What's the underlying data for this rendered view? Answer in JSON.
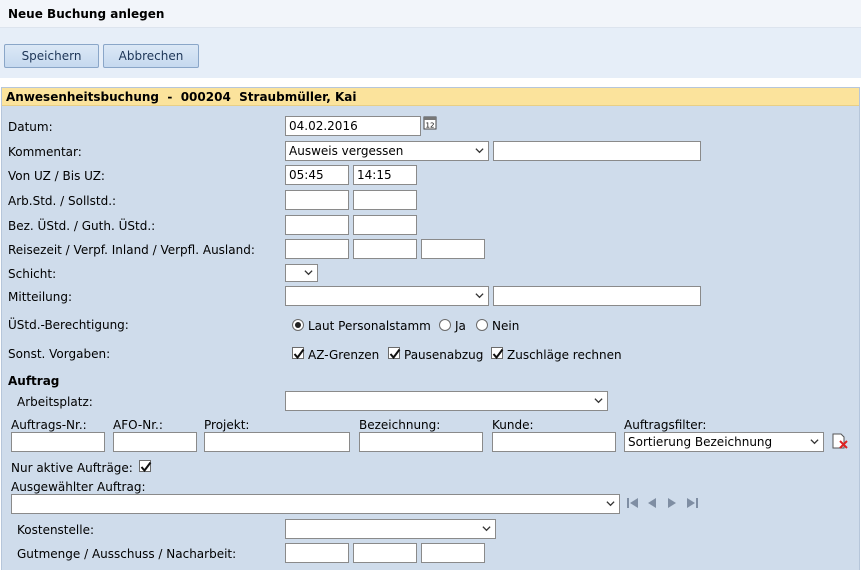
{
  "window": {
    "title": "Neue Buchung anlegen"
  },
  "toolbar": {
    "save_label": "Speichern",
    "cancel_label": "Abbrechen"
  },
  "panel": {
    "header": "Anwesenheitsbuchung  -  000204  Straubmüller, Kai"
  },
  "form": {
    "datum": {
      "label": "Datum:",
      "value": "04.02.2016"
    },
    "kommentar": {
      "label": "Kommentar:",
      "selected": "Ausweis vergessen",
      "text": ""
    },
    "von_bis": {
      "label": "Von UZ / Bis UZ:",
      "von": "05:45",
      "bis": "14:15"
    },
    "arb_soll": {
      "label": "Arb.Std. / Sollstd.:"
    },
    "bez_guth": {
      "label": "Bez. ÜStd. / Guth. ÜStd.:"
    },
    "reisezeit": {
      "label": "Reisezeit / Verpf. Inland / Verpfl. Ausland:"
    },
    "schicht": {
      "label": "Schicht:"
    },
    "mitteilung": {
      "label": "Mitteilung:"
    },
    "ustd": {
      "label": "ÜStd.-Berechtigung:",
      "options": [
        "Laut Personalstamm",
        "Ja",
        "Nein"
      ],
      "selected": "Laut Personalstamm"
    },
    "vorgaben": {
      "label": "Sonst. Vorgaben:",
      "options": [
        {
          "label": "AZ-Grenzen",
          "checked": true
        },
        {
          "label": "Pausenabzug",
          "checked": true
        },
        {
          "label": "Zuschläge rechnen",
          "checked": true
        }
      ]
    }
  },
  "auftrag": {
    "section_title": "Auftrag",
    "arbeitsplatz_label": "Arbeitsplatz:",
    "columns": {
      "auftrags_nr": "Auftrags-Nr.:",
      "afo_nr": "AFO-Nr.:",
      "projekt": "Projekt:",
      "bezeichnung": "Bezeichnung:",
      "kunde": "Kunde:",
      "filter": "Auftragsfilter:"
    },
    "filter_selected": "Sortierung Bezeichnung",
    "nur_aktive_label": "Nur aktive Aufträge:",
    "nur_aktive_checked": true,
    "ausgewaehlt_label": "Ausgewählter Auftrag:",
    "kostenstelle_label": "Kostenstelle:",
    "gutmenge_label": "Gutmenge / Ausschuss / Nacharbeit:"
  },
  "icons": {
    "calendar": "calendar-icon",
    "clear_filter": "clear-filter-icon",
    "nav": [
      "first-icon",
      "prev-icon",
      "next-icon",
      "last-icon"
    ]
  },
  "colors": {
    "panel_bg": "#cfdceb",
    "header_bg": "#fbe39c",
    "toolbar_bg": "#e6eef8"
  }
}
